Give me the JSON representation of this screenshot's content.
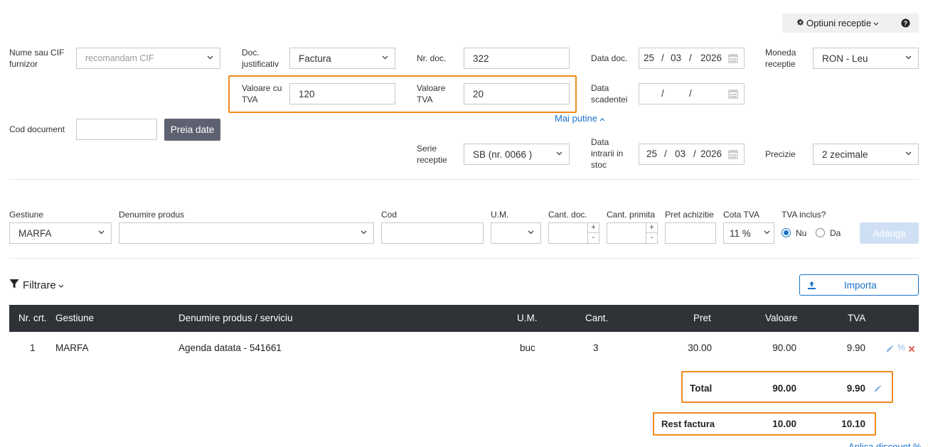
{
  "top": {
    "options_label": "Optiuni receptie",
    "help_icon": "question-circle-icon"
  },
  "form": {
    "supplier_label": "Nume sau CIF furnizor",
    "supplier_placeholder": "recomandam CIF",
    "doc_label": "Doc. justificativ",
    "doc_value": "Factura",
    "nrdoc_label": "Nr. doc.",
    "nrdoc_value": "322",
    "datadoc_label": "Data doc.",
    "datadoc_day": "25",
    "datadoc_month": "03",
    "datadoc_year": "2026",
    "currency_label": "Moneda receptie",
    "currency_value": "RON - Leu",
    "valcutva_label": "Valoare cu TVA",
    "valcutva_value": "120",
    "valtva_label": "Valoare TVA",
    "valtva_value": "20",
    "scad_label": "Data scadentei",
    "mai_putine": "Mai putine",
    "coddoc_label": "Cod document",
    "preia_label": "Preia date",
    "serie_label": "Serie receptie",
    "serie_value": "SB (nr. 0066 )",
    "dataintr_label": "Data intrarii in stoc",
    "dataintr_day": "25",
    "dataintr_month": "03",
    "dataintr_year": "2026",
    "precizie_label": "Precizie",
    "precizie_value": "2 zecimale",
    "date_sep": "/"
  },
  "add_row": {
    "gestiune_label": "Gestiune",
    "gestiune_value": "MARFA",
    "denumire_label": "Denumire produs",
    "cod_label": "Cod",
    "um_label": "U.M.",
    "cantdoc_label": "Cant. doc.",
    "cantprim_label": "Cant. primita",
    "pret_label": "Pret achizitie",
    "cota_label": "Cota TVA",
    "cota_value": "11 %",
    "tvainclus_label": "TVA inclus?",
    "nu_label": "Nu",
    "da_label": "Da",
    "tvainclus_selected": "Nu",
    "adauga_label": "Adauga",
    "plus": "+",
    "minus": "-"
  },
  "filter": {
    "filtrare_label": "Filtrare",
    "importa_label": "Importa"
  },
  "table": {
    "headers": [
      "Nr. crt.",
      "Gestiune",
      "Denumire produs / serviciu",
      "U.M.",
      "Cant.",
      "Pret",
      "Valoare",
      "TVA"
    ],
    "rows": [
      {
        "nr": "1",
        "gestiune": "MARFA",
        "denumire": "Agenda datata - 541661",
        "um": "buc",
        "cant": "3",
        "pret": "30.00",
        "valoare": "90.00",
        "tva": "9.90",
        "percent": "%"
      }
    ],
    "total_label": "Total",
    "total_valoare": "90.00",
    "total_tva": "9.90",
    "rest_label": "Rest factura",
    "rest_valoare": "10.00",
    "rest_tva": "10.10",
    "discount_label": "Aplica discount %"
  },
  "colors": {
    "accent": "#1a73c9",
    "highlight": "#f08a1c",
    "table_header": "#2f3237",
    "dark_button": "#5e6270",
    "disabled_button": "#cfe0f5",
    "delete": "#e0605a"
  }
}
